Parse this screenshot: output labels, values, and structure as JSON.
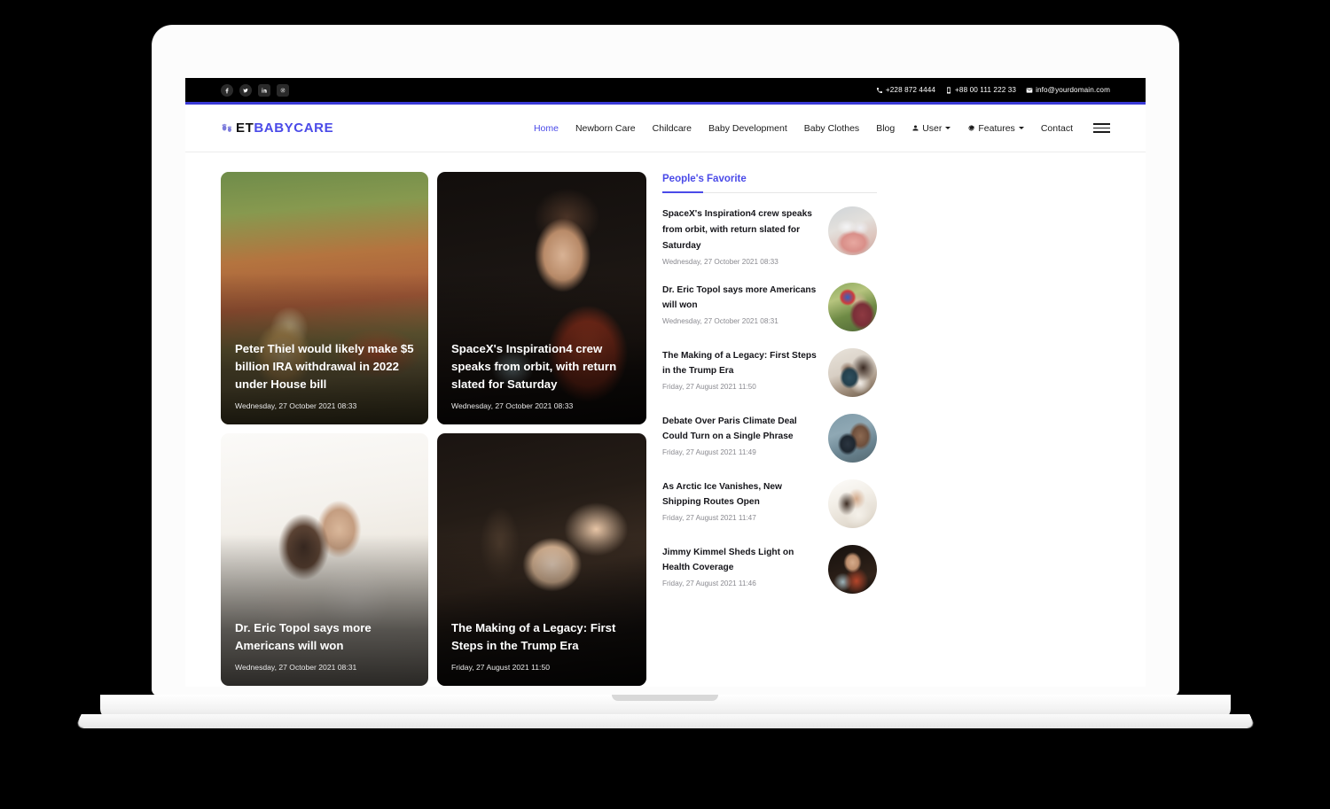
{
  "topbar": {
    "social": [
      {
        "name": "facebook-icon",
        "label": "Facebook"
      },
      {
        "name": "twitter-icon",
        "label": "Twitter"
      },
      {
        "name": "linkedin-icon",
        "label": "LinkedIn"
      },
      {
        "name": "instagram-icon",
        "label": "Instagram"
      }
    ],
    "phone": "+228 872 4444",
    "mobile": "+88 00 111 222 33",
    "email": "info@yourdomain.com"
  },
  "header": {
    "logo_et": "ET",
    "logo_babycare": "BABYCARE",
    "nav": [
      {
        "label": "Home",
        "active": true,
        "icon": null,
        "caret": false
      },
      {
        "label": "Newborn Care",
        "active": false,
        "icon": null,
        "caret": false
      },
      {
        "label": "Childcare",
        "active": false,
        "icon": null,
        "caret": false
      },
      {
        "label": "Baby Development",
        "active": false,
        "icon": null,
        "caret": false
      },
      {
        "label": "Baby Clothes",
        "active": false,
        "icon": null,
        "caret": false
      },
      {
        "label": "Blog",
        "active": false,
        "icon": null,
        "caret": false
      },
      {
        "label": "User",
        "active": false,
        "icon": "user-icon",
        "caret": true
      },
      {
        "label": "Features",
        "active": false,
        "icon": "gear-icon",
        "caret": true
      },
      {
        "label": "Contact",
        "active": false,
        "icon": null,
        "caret": false
      }
    ]
  },
  "featured": [
    {
      "title": "Peter Thiel would likely make $5 billion IRA withdrawal in 2022 under House bill",
      "date": "Wednesday, 27 October 2021 08:33",
      "photo_class": "ph-thiel"
    },
    {
      "title": "SpaceX's Inspiration4 crew speaks from orbit, with return slated for Saturday",
      "date": "Wednesday, 27 October 2021 08:33",
      "photo_class": "ph-spacex"
    },
    {
      "title": "Dr. Eric Topol says more Americans will won",
      "date": "Wednesday, 27 October 2021 08:31",
      "photo_class": "ph-topol"
    },
    {
      "title": "The Making of a Legacy: First Steps in the Trump Era",
      "date": "Friday, 27 August 2021 11:50",
      "photo_class": "ph-legacy"
    }
  ],
  "sidebar": {
    "heading": "People's Favorite",
    "items": [
      {
        "title": "SpaceX's Inspiration4 crew speaks from orbit, with return slated for Saturday",
        "date": "Wednesday, 27 October 2021 08:33",
        "thumb_class": "th-1"
      },
      {
        "title": "Dr. Eric Topol says more Americans will won",
        "date": "Wednesday, 27 October 2021 08:31",
        "thumb_class": "th-2"
      },
      {
        "title": "The Making of a Legacy: First Steps in the Trump Era",
        "date": "Friday, 27 August 2021 11:50",
        "thumb_class": "th-3"
      },
      {
        "title": "Debate Over Paris Climate Deal Could Turn on a Single Phrase",
        "date": "Friday, 27 August 2021 11:49",
        "thumb_class": "th-4"
      },
      {
        "title": "As Arctic Ice Vanishes, New Shipping Routes Open",
        "date": "Friday, 27 August 2021 11:47",
        "thumb_class": "th-5"
      },
      {
        "title": "Jimmy Kimmel Sheds Light on Health Coverage",
        "date": "Friday, 27 August 2021 11:46",
        "thumb_class": "th-6"
      }
    ]
  },
  "colors": {
    "accent": "#4a4ae8",
    "topbar_bg": "#000000",
    "accent_rule": "#3a3ad6",
    "text_dark": "#15151a",
    "text_muted": "#8a8a90"
  }
}
